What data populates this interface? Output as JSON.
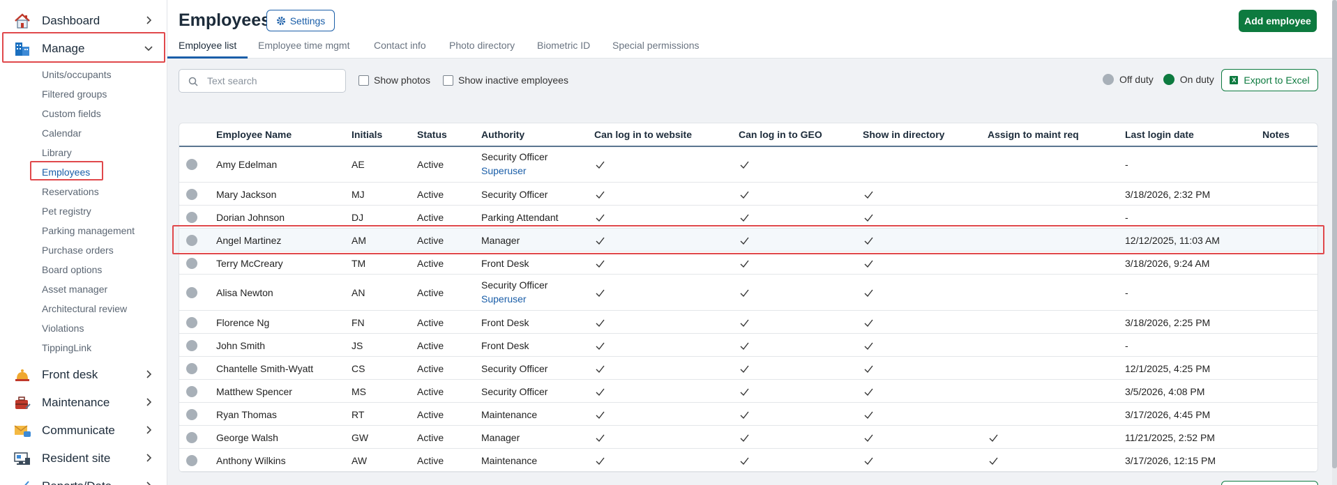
{
  "sidebar": {
    "main_items": [
      {
        "label": "Dashboard",
        "icon": "home-icon",
        "chevron": "right"
      },
      {
        "label": "Manage",
        "icon": "building-icon",
        "chevron": "down"
      },
      {
        "label": "Front desk",
        "icon": "bell-icon",
        "chevron": "right"
      },
      {
        "label": "Maintenance",
        "icon": "toolbox-icon",
        "chevron": "right"
      },
      {
        "label": "Communicate",
        "icon": "mail-icon",
        "chevron": "right"
      },
      {
        "label": "Resident site",
        "icon": "monitor-icon",
        "chevron": "right"
      },
      {
        "label": "Reports/Data",
        "icon": "chart-icon",
        "chevron": "right"
      }
    ],
    "sub_items": [
      "Units/occupants",
      "Filtered groups",
      "Custom fields",
      "Calendar",
      "Library",
      "Employees",
      "Reservations",
      "Pet registry",
      "Parking management",
      "Purchase orders",
      "Board options",
      "Asset manager",
      "Architectural review",
      "Violations",
      "TippingLink"
    ],
    "active_sub": "Employees"
  },
  "header": {
    "title": "Employees",
    "settings_label": "Settings",
    "add_label": "Add employee"
  },
  "tabs": [
    "Employee list",
    "Employee time mgmt",
    "Contact info",
    "Photo directory",
    "Biometric ID",
    "Special permissions"
  ],
  "toolbar": {
    "search_placeholder": "Text search",
    "show_photos": "Show photos",
    "show_inactive": "Show inactive employees",
    "off_duty": "Off duty",
    "on_duty": "On duty",
    "export_label": "Export to Excel"
  },
  "colors": {
    "accent": "#1a5ea8",
    "green": "#0d7a3f",
    "off_duty": "#a8b0b8",
    "on_duty": "#0d7a3f",
    "highlight": "#e0484b"
  },
  "table": {
    "columns": [
      "Employee Name",
      "Initials",
      "Status",
      "Authority",
      "Can log in to website",
      "Can log in to GEO",
      "Show in directory",
      "Assign to maint req",
      "Last login date",
      "Notes"
    ],
    "rows": [
      {
        "name": "Amy Edelman",
        "initials": "AE",
        "status": "Active",
        "authority": "Security Officer",
        "sub": "Superuser",
        "web": true,
        "geo": true,
        "dir": false,
        "maint": false,
        "last": "-",
        "notes": ""
      },
      {
        "name": "Mary Jackson",
        "initials": "MJ",
        "status": "Active",
        "authority": "Security Officer",
        "sub": "",
        "web": true,
        "geo": true,
        "dir": true,
        "maint": false,
        "last": "3/18/2026, 2:32 PM",
        "notes": ""
      },
      {
        "name": "Dorian Johnson",
        "initials": "DJ",
        "status": "Active",
        "authority": "Parking Attendant",
        "sub": "",
        "web": true,
        "geo": true,
        "dir": true,
        "maint": false,
        "last": "-",
        "notes": ""
      },
      {
        "name": "Angel Martinez",
        "initials": "AM",
        "status": "Active",
        "authority": "Manager",
        "sub": "",
        "web": true,
        "geo": true,
        "dir": true,
        "maint": false,
        "last": "12/12/2025, 11:03 AM",
        "notes": ""
      },
      {
        "name": "Terry McCreary",
        "initials": "TM",
        "status": "Active",
        "authority": "Front Desk",
        "sub": "",
        "web": true,
        "geo": true,
        "dir": true,
        "maint": false,
        "last": "3/18/2026, 9:24 AM",
        "notes": ""
      },
      {
        "name": "Alisa Newton",
        "initials": "AN",
        "status": "Active",
        "authority": "Security Officer",
        "sub": "Superuser",
        "web": true,
        "geo": true,
        "dir": true,
        "maint": false,
        "last": "-",
        "notes": ""
      },
      {
        "name": "Florence Ng",
        "initials": "FN",
        "status": "Active",
        "authority": "Front Desk",
        "sub": "",
        "web": true,
        "geo": true,
        "dir": true,
        "maint": false,
        "last": "3/18/2026, 2:25 PM",
        "notes": ""
      },
      {
        "name": "John Smith",
        "initials": "JS",
        "status": "Active",
        "authority": "Front Desk",
        "sub": "",
        "web": true,
        "geo": true,
        "dir": true,
        "maint": false,
        "last": "-",
        "notes": ""
      },
      {
        "name": "Chantelle Smith-Wyatt",
        "initials": "CS",
        "status": "Active",
        "authority": "Security Officer",
        "sub": "",
        "web": true,
        "geo": true,
        "dir": true,
        "maint": false,
        "last": "12/1/2025, 4:25 PM",
        "notes": ""
      },
      {
        "name": "Matthew Spencer",
        "initials": "MS",
        "status": "Active",
        "authority": "Security Officer",
        "sub": "",
        "web": true,
        "geo": true,
        "dir": true,
        "maint": false,
        "last": "3/5/2026, 4:08 PM",
        "notes": ""
      },
      {
        "name": "Ryan Thomas",
        "initials": "RT",
        "status": "Active",
        "authority": "Maintenance",
        "sub": "",
        "web": true,
        "geo": true,
        "dir": true,
        "maint": false,
        "last": "3/17/2026, 4:45 PM",
        "notes": ""
      },
      {
        "name": "George Walsh",
        "initials": "GW",
        "status": "Active",
        "authority": "Manager",
        "sub": "",
        "web": true,
        "geo": true,
        "dir": true,
        "maint": true,
        "last": "11/21/2025, 2:52 PM",
        "notes": ""
      },
      {
        "name": "Anthony Wilkins",
        "initials": "AW",
        "status": "Active",
        "authority": "Maintenance",
        "sub": "",
        "web": true,
        "geo": true,
        "dir": true,
        "maint": true,
        "last": "3/17/2026, 12:15 PM",
        "notes": ""
      }
    ]
  }
}
